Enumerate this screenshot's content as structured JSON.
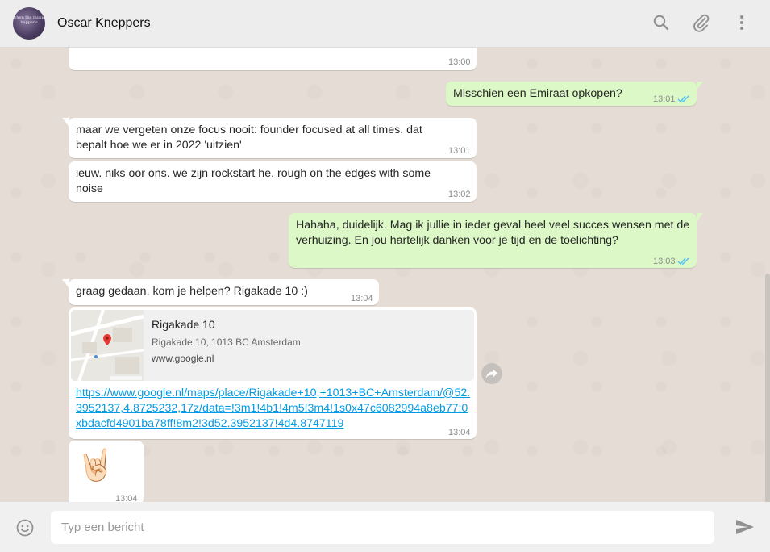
{
  "contact": {
    "name": "Oscar Kneppers",
    "avatar_text": "when the music happens"
  },
  "messages": [
    {
      "dir": "in",
      "text": "",
      "time": "13:00"
    },
    {
      "dir": "out",
      "text": "Misschien een Emiraat opkopen?",
      "time": "13:01",
      "read": true
    },
    {
      "dir": "in",
      "text": "maar we vergeten onze focus nooit: founder focused at all times. dat bepalt hoe we er in 2022 'uitzien'",
      "time": "13:01"
    },
    {
      "dir": "in",
      "text": "ieuw. niks oor ons. we zijn rockstart he. rough on the edges with some noise",
      "time": "13:02"
    },
    {
      "dir": "out",
      "text": "Hahaha, duidelijk. Mag ik jullie in ieder geval heel veel succes wensen met de verhuizing. En jou hartelijk danken voor je tijd en de toelichting?",
      "time": "13:03",
      "read": true
    },
    {
      "dir": "in",
      "text": "graag gedaan. kom je helpen? Rigakade 10 :)",
      "time": "13:04"
    },
    {
      "dir": "in",
      "type": "location",
      "title": "Rigakade 10",
      "address": "Rigakade 10, 1013 BC Amsterdam",
      "site": "www.google.nl",
      "link": "https://www.google.nl/maps/place/Rigakade+10,+1013+BC+Amsterdam/@52.3952137,4.8725232,17z/data=!3m1!4b1!4m5!3m4!1s0x47c6082994a8eb77:0xbdacfd4901ba78ff!8m2!3d52.3952137!4d4.8747119",
      "time": "13:04"
    },
    {
      "dir": "in",
      "type": "sticker",
      "emoji": "🤘🏻",
      "time": "13:04"
    }
  ],
  "composer": {
    "placeholder": "Typ een bericht"
  },
  "colors": {
    "outgoing_bubble": "#dcf8c6",
    "incoming_bubble": "#ffffff",
    "read_ticks": "#4fc3f7",
    "chat_background": "#e5ddd5"
  },
  "icons": {
    "search": "search-icon",
    "attach": "paperclip-icon",
    "menu": "more-vertical-icon",
    "emoji": "smiley-icon",
    "send": "send-icon",
    "forward": "forward-icon"
  }
}
